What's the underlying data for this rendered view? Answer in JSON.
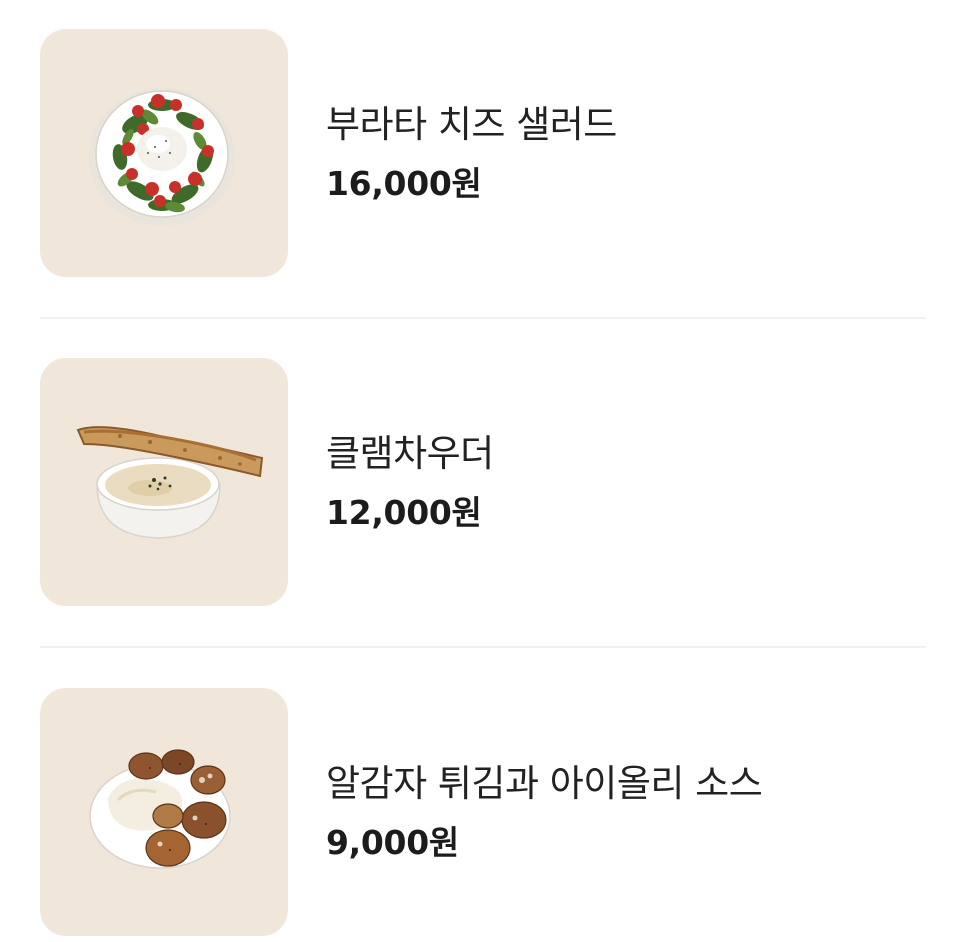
{
  "menu": {
    "items": [
      {
        "name": "부라타 치즈 샐러드",
        "price": "16,000원",
        "image_icon": "burrata-salad-image"
      },
      {
        "name": "클램차우더",
        "price": "12,000원",
        "image_icon": "clam-chowder-image"
      },
      {
        "name": "알감자 튀김과 아이올리 소스",
        "price": "9,000원",
        "image_icon": "fried-potato-image"
      }
    ]
  },
  "colors": {
    "thumb_background": "#f0e7da",
    "divider": "#f1f1f1",
    "text": "#222222"
  }
}
